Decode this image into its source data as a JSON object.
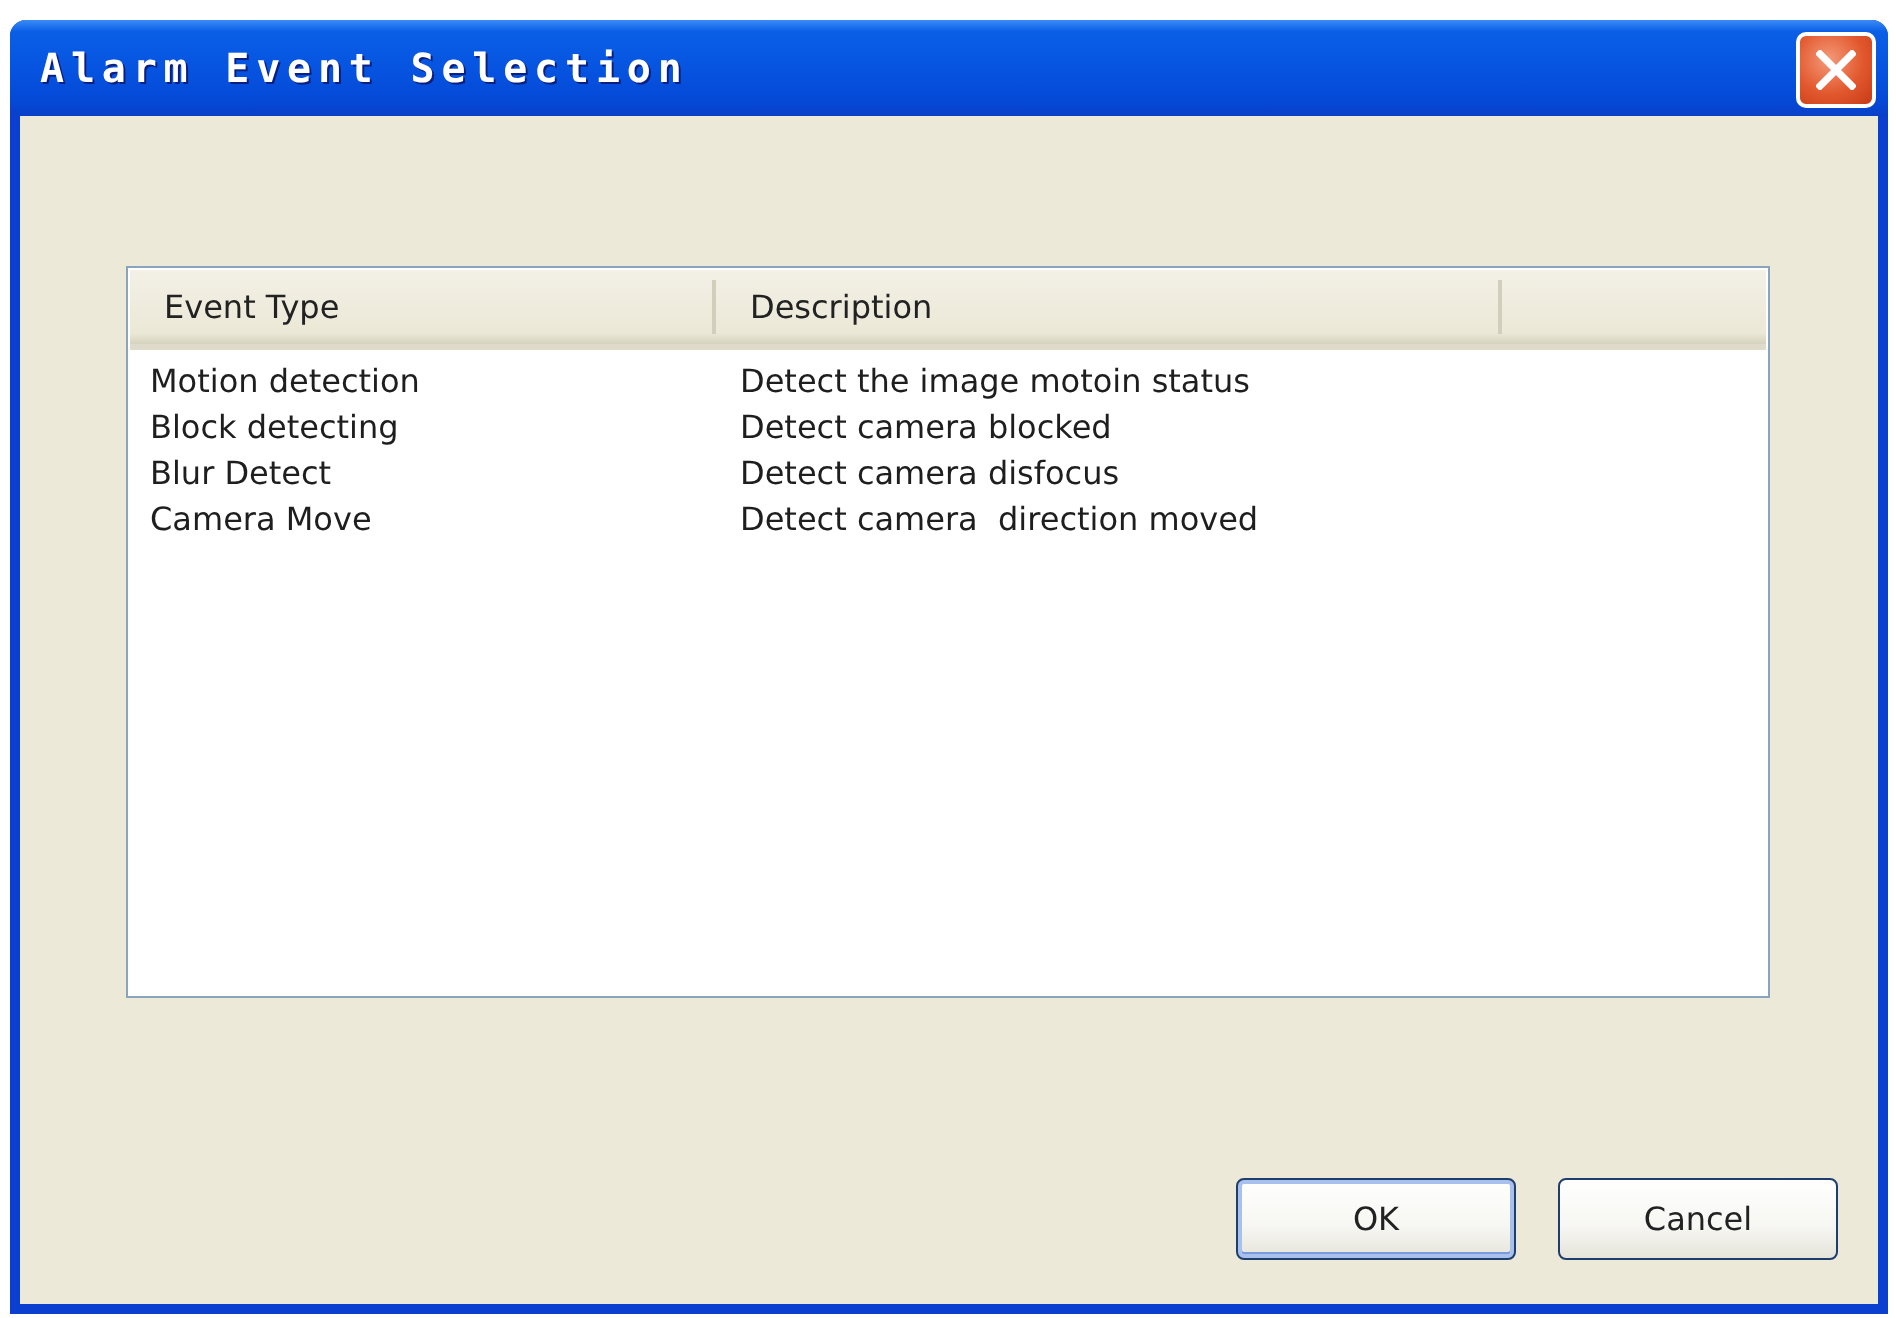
{
  "window": {
    "title": "Alarm Event Selection"
  },
  "list": {
    "columns": [
      "Event Type",
      "Description"
    ],
    "rows": [
      {
        "cells": [
          "Motion detection",
          "Detect the image motoin status"
        ],
        "selected": false
      },
      {
        "cells": [
          "Block detecting",
          "Detect camera blocked"
        ],
        "selected": false
      },
      {
        "cells": [
          "Blur Detect",
          "Detect camera disfocus"
        ],
        "selected": false
      },
      {
        "cells": [
          "Camera Move",
          "Detect camera  direction moved"
        ],
        "selected": false
      }
    ]
  },
  "buttons": [
    {
      "label": "OK",
      "default": true
    },
    {
      "label": "Cancel",
      "default": false
    }
  ]
}
